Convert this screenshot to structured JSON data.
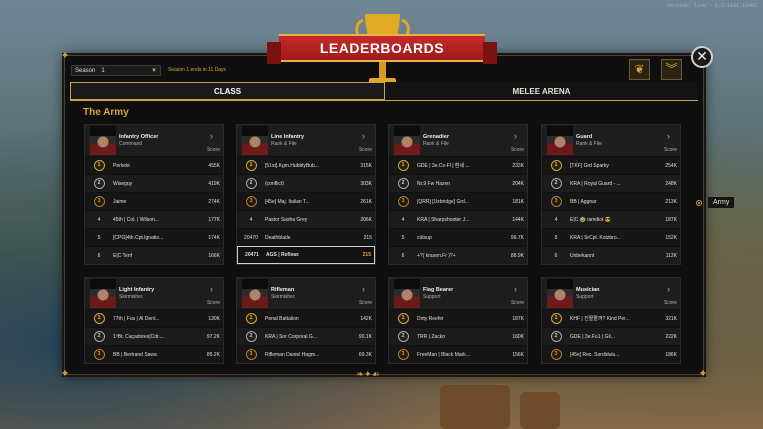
{
  "version": "Version: live - 1.2.1101.16405",
  "title": "LEADERBOARDS",
  "season": {
    "label": "Season",
    "value": "1",
    "note": "Season 1 ends in 11 Days"
  },
  "tabs": [
    {
      "label": "CLASS",
      "active": true
    },
    {
      "label": "MELEE ARENA",
      "active": false
    }
  ],
  "section_title": "The Army",
  "side_filter": "Army",
  "score_label": "Score",
  "cards": [
    {
      "name": "Infantry Officer",
      "rank": "Command",
      "rows": [
        {
          "pos": "1",
          "name": "Perkele",
          "score": "455K"
        },
        {
          "pos": "2",
          "name": "Wiseguy",
          "score": "419K"
        },
        {
          "pos": "3",
          "name": "Jaime",
          "score": "274K"
        },
        {
          "pos": "4",
          "name": "45th | Col. | Wilson...",
          "score": "177K"
        },
        {
          "pos": "5",
          "name": "[CPG]4th.Cpt.Ignatio...",
          "score": "174K"
        },
        {
          "pos": "6",
          "name": "E|C Tenf",
          "score": "166K"
        }
      ]
    },
    {
      "name": "Line Infantry",
      "rank": "Rank & File",
      "rows": [
        {
          "pos": "1",
          "name": "[51st].Kgm.HubblyBub...",
          "score": "315K"
        },
        {
          "pos": "2",
          "name": "(conflict)",
          "score": "303K"
        },
        {
          "pos": "3",
          "name": "[45e] Maj. Italian T...",
          "score": "261K"
        },
        {
          "pos": "4",
          "name": "Pastor Sasha Grey",
          "score": "206K"
        },
        {
          "pos": "20470",
          "name": "Deathblade",
          "score": "215"
        },
        {
          "pos": "20471",
          "name": "AGS | Refleax",
          "score": "215",
          "me": true
        }
      ]
    },
    {
      "name": "Grenadier",
      "rank": "Rank & File",
      "rows": [
        {
          "pos": "1",
          "name": "GDE | 3e.Cs-Fl | 환세 ...",
          "score": "233K"
        },
        {
          "pos": "2",
          "name": "Nr.9 Fw Hazen",
          "score": "204K"
        },
        {
          "pos": "3",
          "name": "[QRR] [Uxbridge] Grd...",
          "score": "181K"
        },
        {
          "pos": "4",
          "name": "KRA | Sharpshooter J...",
          "score": "144K"
        },
        {
          "pos": "5",
          "name": "cútsup",
          "score": "96.7K"
        },
        {
          "pos": "6",
          "name": "+?( kraxen.Fr )?+",
          "score": "88.9K"
        }
      ]
    },
    {
      "name": "Guard",
      "rank": "Rank & File",
      "rows": [
        {
          "pos": "1",
          "name": "[TKF] Grd Sparky",
          "score": "254K"
        },
        {
          "pos": "2",
          "name": "KRA | Royal Guard - ...",
          "score": "248K"
        },
        {
          "pos": "3",
          "name": "BB | Aggnar",
          "score": "213K"
        },
        {
          "pos": "4",
          "name": "E|C 🥸 iamdiot 😎",
          "score": "187K"
        },
        {
          "pos": "5",
          "name": "KRA | SrCpl. Kotzbro...",
          "score": "152K"
        },
        {
          "pos": "6",
          "name": "Unbekannt",
          "score": "112K"
        }
      ]
    },
    {
      "name": "Light Infantry",
      "rank": "Skirmisher",
      "rows": [
        {
          "pos": "1",
          "name": "77th | Fus | Al Dent...",
          "score": "130K"
        },
        {
          "pos": "2",
          "name": "1ºBt. Caçadores|Cdr....",
          "score": "97.2K"
        },
        {
          "pos": "3",
          "name": "BB | Bertrand Sawa",
          "score": "85.2K"
        }
      ]
    },
    {
      "name": "Rifleman",
      "rank": "Skirmisher",
      "rows": [
        {
          "pos": "1",
          "name": "Penal Battalion",
          "score": "142K"
        },
        {
          "pos": "2",
          "name": "KRA | Snr Corporal G...",
          "score": "90.1K"
        },
        {
          "pos": "3",
          "name": "Rifleman Daniel Hagm...",
          "score": "69.3K"
        }
      ]
    },
    {
      "name": "Flag Bearer",
      "rank": "Support",
      "rows": [
        {
          "pos": "1",
          "name": "Dirty Reefer",
          "score": "187K"
        },
        {
          "pos": "2",
          "name": "TRR | Zacko",
          "score": "160K"
        },
        {
          "pos": "3",
          "name": "FreeMan | Black Mark...",
          "score": "156K"
        }
      ]
    },
    {
      "name": "Musician",
      "rank": "Support",
      "rows": [
        {
          "pos": "1",
          "name": "KHF | 진짤짤까? Kind Per...",
          "score": "321K"
        },
        {
          "pos": "2",
          "name": "GDE | 3e.Fu1 | Gil...",
          "score": "222K"
        },
        {
          "pos": "3",
          "name": "[45e] Rec. Sordidulu...",
          "score": "186K"
        }
      ]
    }
  ]
}
